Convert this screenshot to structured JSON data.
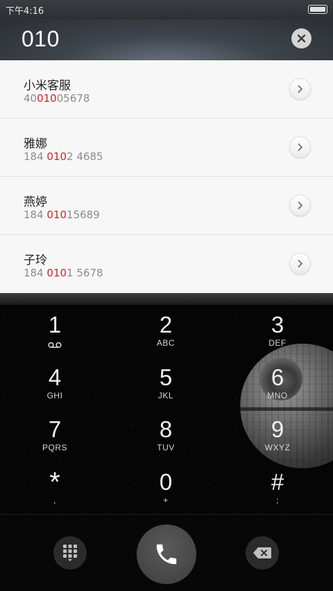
{
  "status_bar": {
    "time": "下午4:16"
  },
  "search": {
    "query": "010"
  },
  "results": [
    {
      "name": "小米客服",
      "number_parts": [
        "40",
        "010",
        "05678"
      ]
    },
    {
      "name": "雅娜",
      "number_parts": [
        "184 ",
        "010",
        "2 4685"
      ]
    },
    {
      "name": "燕婷",
      "number_parts": [
        "184 ",
        "010",
        "15689"
      ]
    },
    {
      "name": "子玲",
      "number_parts": [
        "184 ",
        "010",
        "1 5678"
      ]
    }
  ],
  "keys": [
    {
      "digit": "1",
      "letters": ""
    },
    {
      "digit": "2",
      "letters": "ABC"
    },
    {
      "digit": "3",
      "letters": "DEF"
    },
    {
      "digit": "4",
      "letters": "GHI"
    },
    {
      "digit": "5",
      "letters": "JKL"
    },
    {
      "digit": "6",
      "letters": "MNO"
    },
    {
      "digit": "7",
      "letters": "PQRS"
    },
    {
      "digit": "8",
      "letters": "TUV"
    },
    {
      "digit": "9",
      "letters": "WXYZ"
    },
    {
      "digit": "*",
      "letters": ","
    },
    {
      "digit": "0",
      "letters": "+"
    },
    {
      "digit": "#",
      "letters": ";"
    }
  ],
  "colors": {
    "highlight": "#c9242b",
    "accent": "#3d3d3d"
  },
  "icons": {
    "clear": "close-icon",
    "detail": "chevron-right-icon",
    "voicemail": "voicemail-icon",
    "keypad": "dialpad-icon",
    "call": "phone-icon",
    "backspace": "backspace-icon"
  }
}
